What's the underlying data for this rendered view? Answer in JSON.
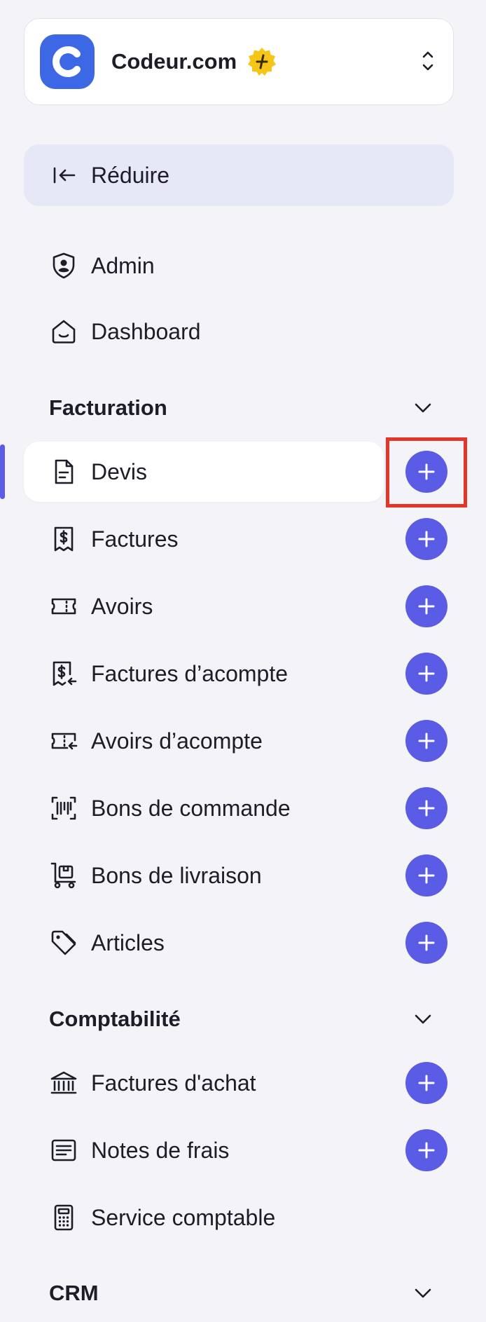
{
  "workspace": {
    "name": "Codeur.com"
  },
  "collapse": {
    "label": "Réduire"
  },
  "top_items": [
    {
      "label": "Admin",
      "icon": "shield-user-icon"
    },
    {
      "label": "Dashboard",
      "icon": "home-icon"
    }
  ],
  "sections": [
    {
      "label": "Facturation"
    },
    {
      "label": "Comptabilité"
    },
    {
      "label": "CRM"
    }
  ],
  "facturation_items": [
    {
      "label": "Devis",
      "icon": "document-icon",
      "active": true
    },
    {
      "label": "Factures",
      "icon": "receipt-dollar-icon"
    },
    {
      "label": "Avoirs",
      "icon": "ticket-icon"
    },
    {
      "label": "Factures d’acompte",
      "icon": "receipt-dollar-arrow-icon"
    },
    {
      "label": "Avoirs d’acompte",
      "icon": "ticket-arrow-icon"
    },
    {
      "label": "Bons de commande",
      "icon": "barcode-scan-icon"
    },
    {
      "label": "Bons de livraison",
      "icon": "trolley-icon"
    },
    {
      "label": "Articles",
      "icon": "tag-icon"
    }
  ],
  "comptabilite_items": [
    {
      "label": "Factures d'achat",
      "icon": "bank-icon"
    },
    {
      "label": "Notes de frais",
      "icon": "note-lines-icon"
    },
    {
      "label": "Service comptable",
      "icon": "calculator-icon"
    }
  ],
  "colors": {
    "accent": "#5b5ce6",
    "logo": "#3c68e6",
    "badge": "#f5c518",
    "highlight": "#e53528"
  }
}
